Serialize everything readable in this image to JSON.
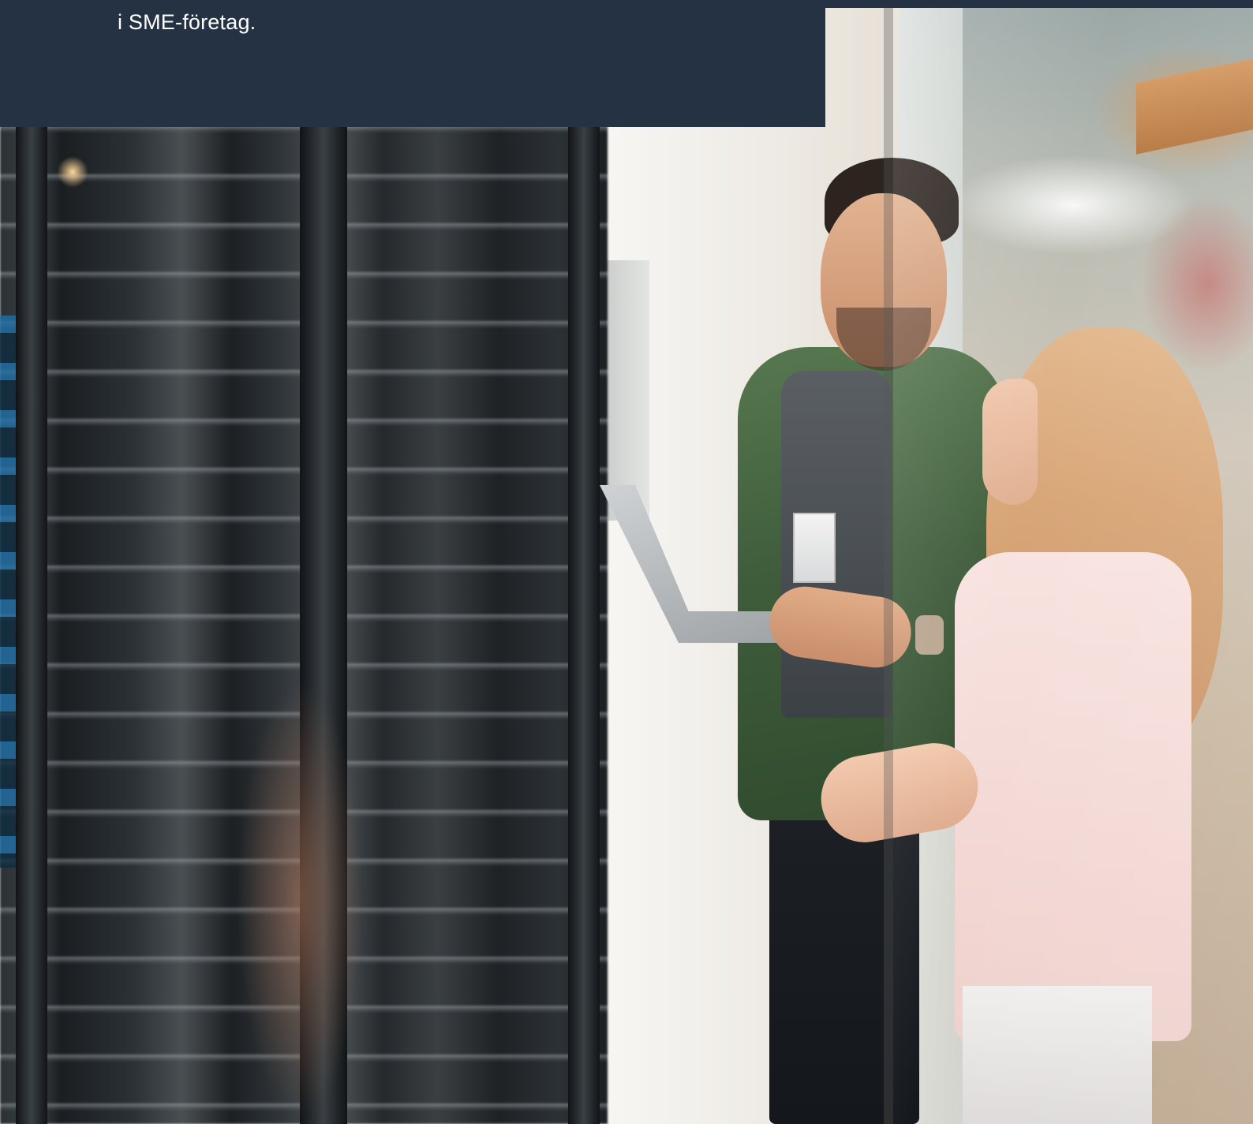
{
  "banner": {
    "text": "i SME-företag.",
    "background_color": "#243243",
    "text_color": "#ffffff"
  },
  "hero_image": {
    "icon": "photo-server-room-two-people"
  }
}
